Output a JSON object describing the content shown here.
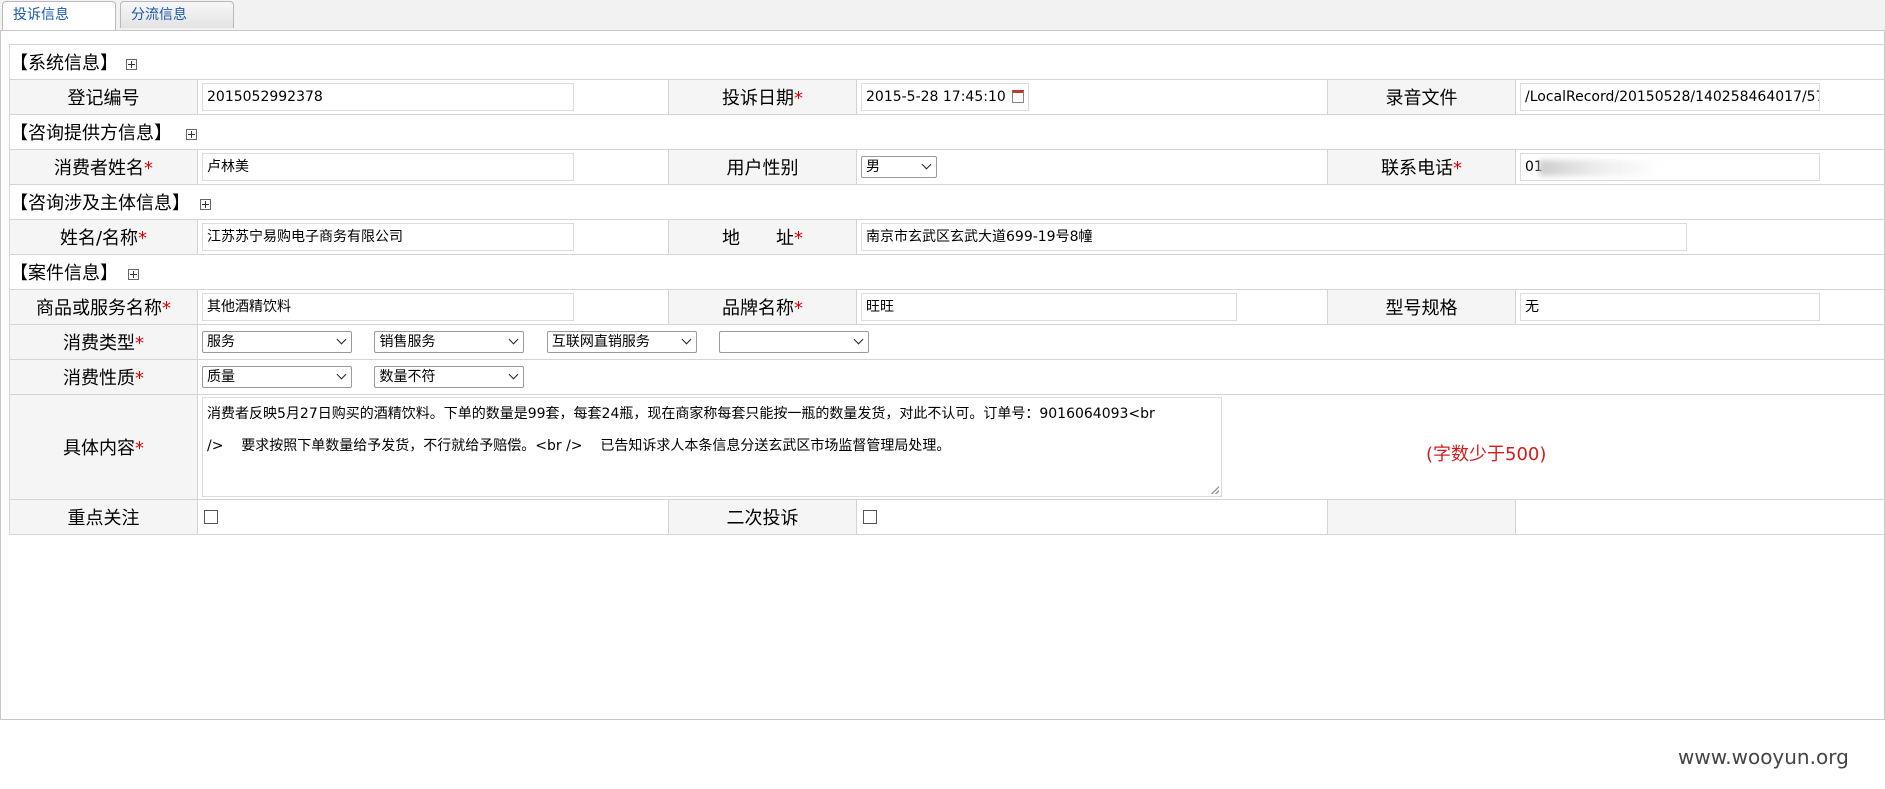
{
  "tabs": [
    {
      "label": "投诉信息",
      "active": true
    },
    {
      "label": "分流信息",
      "active": false
    }
  ],
  "sections": {
    "system": "【系统信息】",
    "provider": "【咨询提供方信息】",
    "subject": "【咨询涉及主体信息】",
    "case": "【案件信息】"
  },
  "system": {
    "reg_no_label": "登记编号",
    "reg_no": "2015052992378",
    "date_label": "投诉日期",
    "date": "2015-5-28 17:45:10",
    "record_label": "录音文件",
    "record": "/LocalRecord/20150528/140258464017/57517"
  },
  "provider": {
    "name_label": "消费者姓名",
    "name": "卢林美",
    "gender_label": "用户性别",
    "gender": "男",
    "phone_label": "联系电话",
    "phone": "01"
  },
  "subject": {
    "name_label": "姓名/名称",
    "name": "江苏苏宁易购电子商务有限公司",
    "addr_label": "地　　址",
    "addr": "南京市玄武区玄武大道699-19号8幢"
  },
  "case": {
    "product_label": "商品或服务名称",
    "product": "其他酒精饮料",
    "brand_label": "品牌名称",
    "brand": "旺旺",
    "model_label": "型号规格",
    "model": "无",
    "ctype_label": "消费类型",
    "ctype": [
      "服务",
      "销售服务",
      "互联网直销服务",
      ""
    ],
    "nature_label": "消费性质",
    "nature": [
      "质量",
      "数量不符"
    ],
    "content_label": "具体内容",
    "content_line1": "消费者反映5月27日购买的酒精饮料。下单的数量是99套，每套24瓶，现在商家称每套只能按一瓶的数量发货，对此不认可。订单号：9016064093<br",
    "content_line2": "/>    要求按照下单数量给予发货，不行就给予赔偿。<br />    已告知诉求人本条信息分送玄武区市场监督管理局处理。",
    "content_hint": "(字数少于500)",
    "focus_label": "重点关注",
    "second_label": "二次投诉"
  },
  "required_mark": "*",
  "watermark": "www.wooyun.org"
}
